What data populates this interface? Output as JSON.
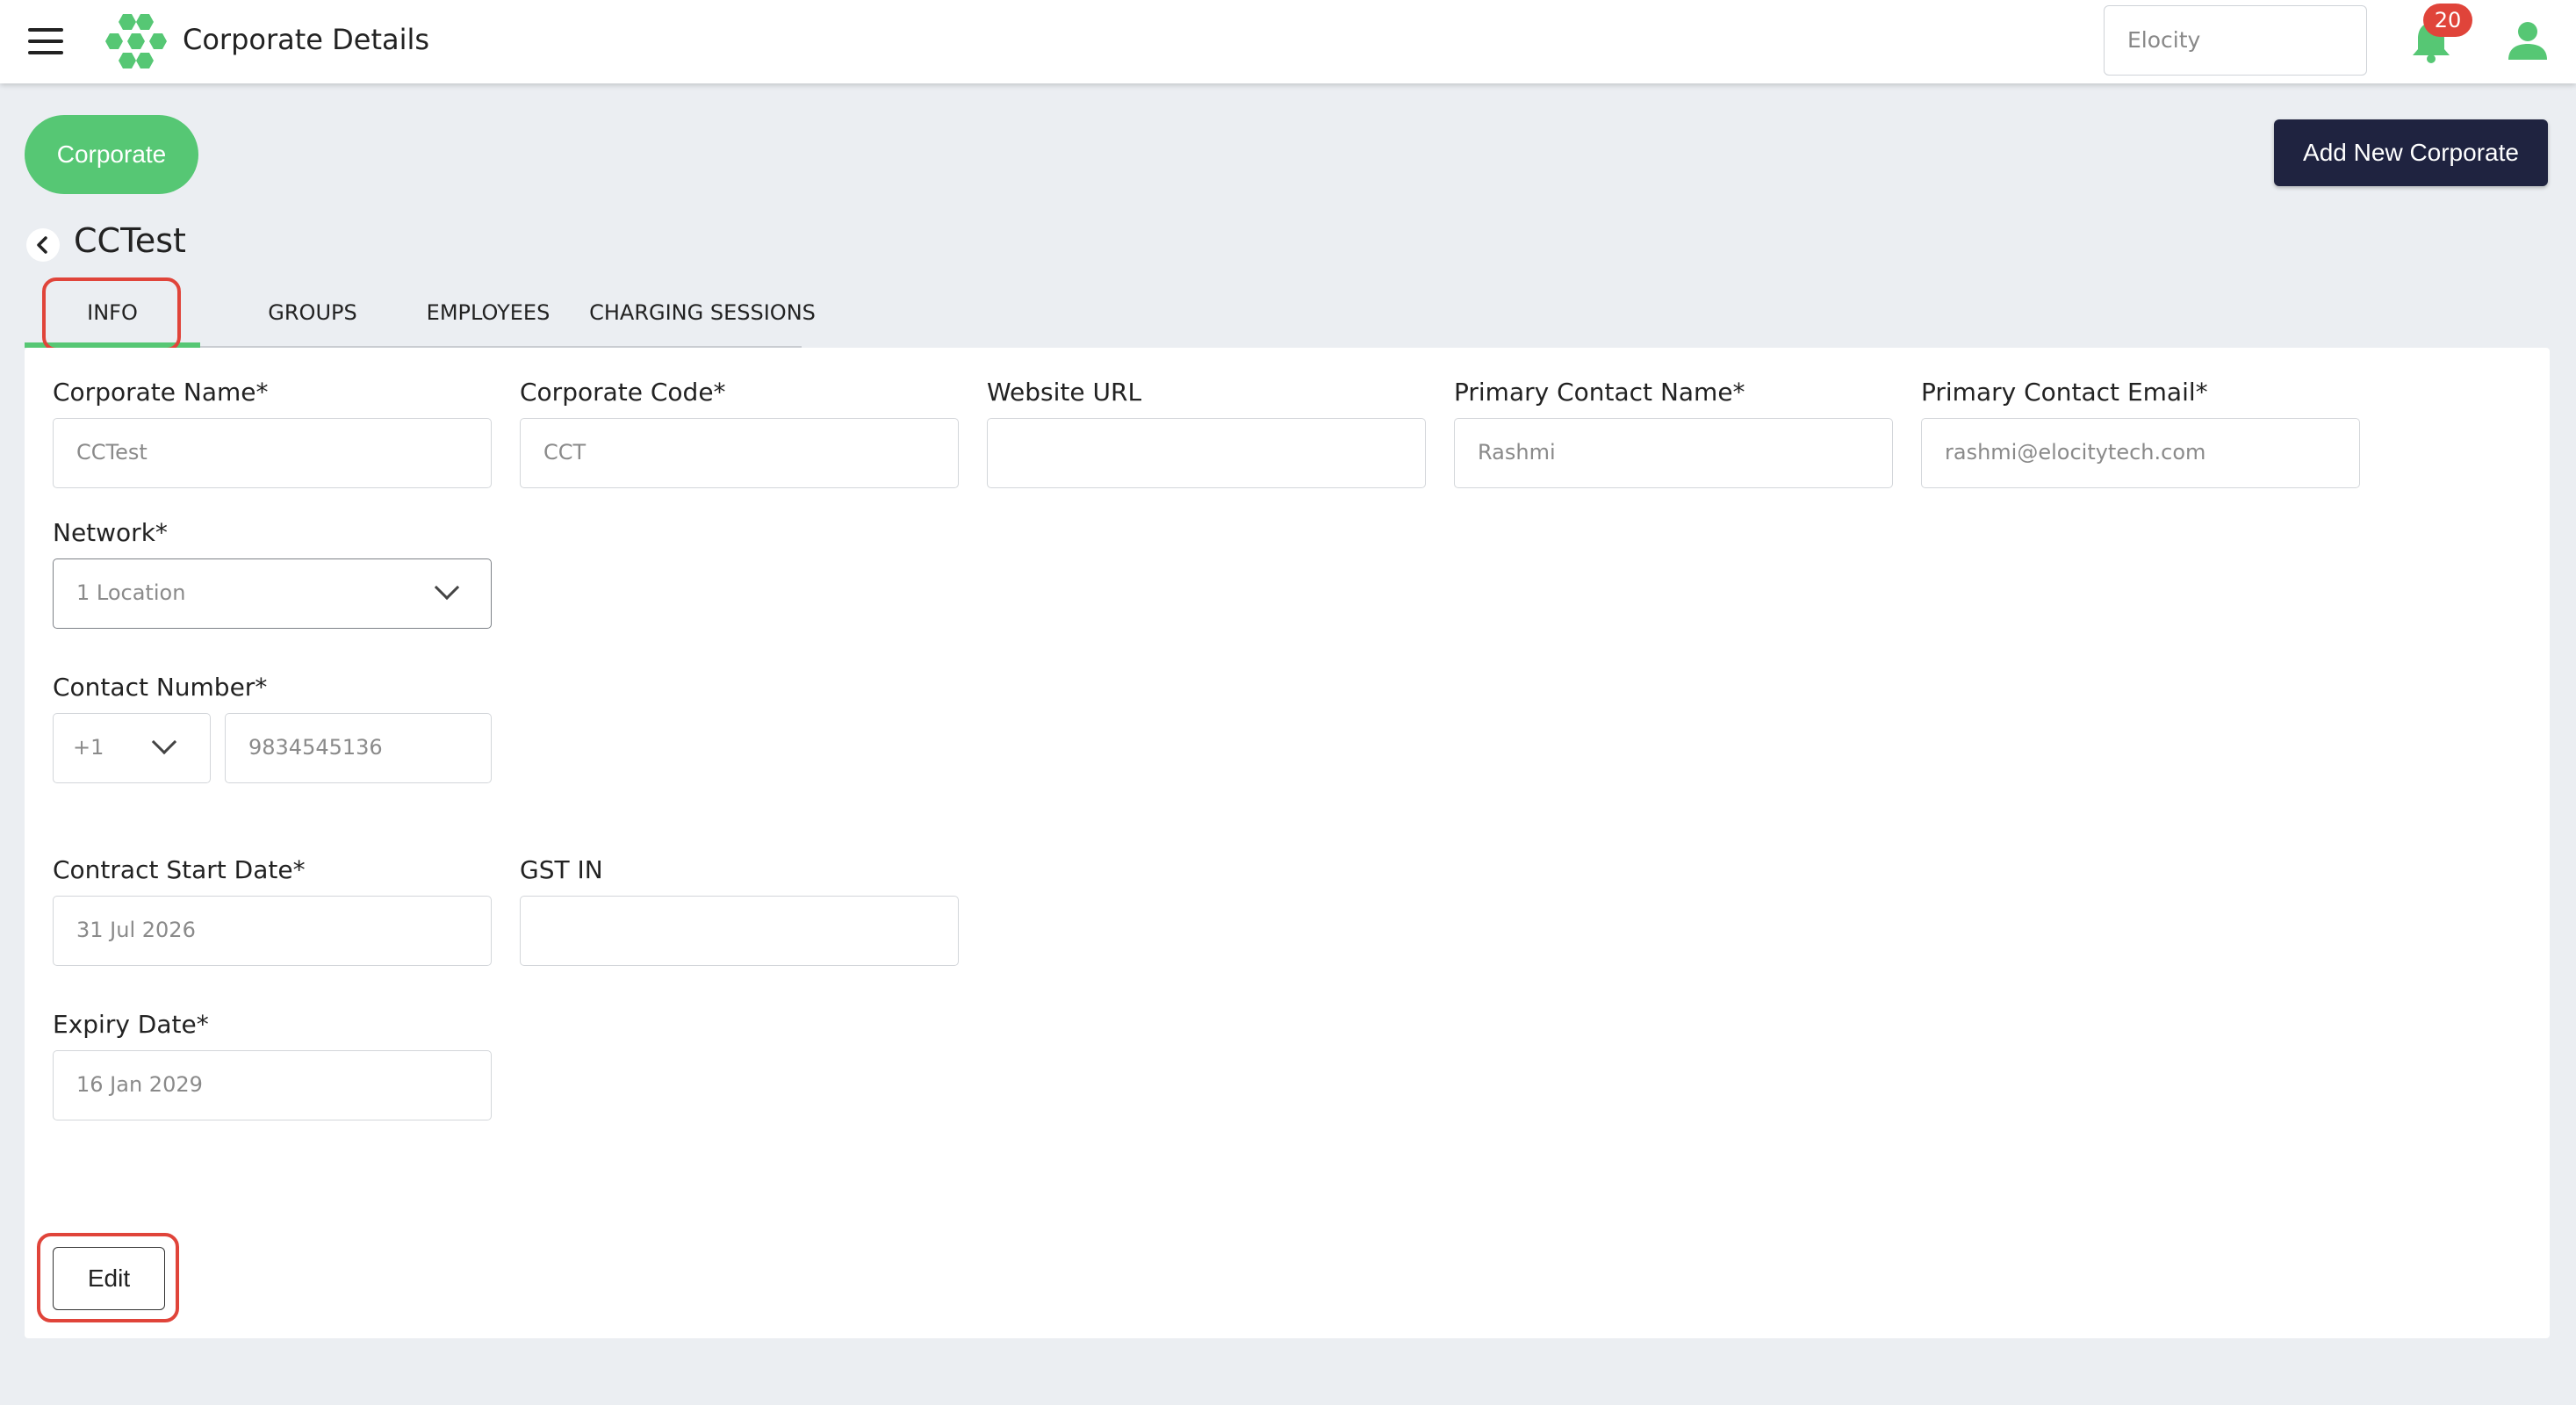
{
  "header": {
    "title": "Corporate Details",
    "search_value": "Elocity",
    "notification_count": "20",
    "brand_color": "#56c774"
  },
  "actions": {
    "corporate_label": "Corporate",
    "add_new_label": "Add New Corporate"
  },
  "page": {
    "corporate_name": "CCTest"
  },
  "tabs": [
    {
      "label": "INFO",
      "active": true
    },
    {
      "label": "GROUPS",
      "active": false
    },
    {
      "label": "EMPLOYEES",
      "active": false
    },
    {
      "label": "CHARGING SESSIONS",
      "active": false
    }
  ],
  "form": {
    "corporate_name": {
      "label": "Corporate Name*",
      "value": "CCTest"
    },
    "corporate_code": {
      "label": "Corporate Code*",
      "value": "CCT"
    },
    "website_url": {
      "label": "Website URL",
      "value": ""
    },
    "primary_contact_name": {
      "label": "Primary Contact Name*",
      "value": "Rashmi"
    },
    "primary_contact_email": {
      "label": "Primary Contact Email*",
      "value": "rashmi@elocitytech.com"
    },
    "network": {
      "label": "Network*",
      "value": "1 Location"
    },
    "contact_number": {
      "label": "Contact Number*",
      "country_code": "+1",
      "value": "9834545136"
    },
    "contract_start_date": {
      "label": "Contract Start Date*",
      "value": "31 Jul 2026"
    },
    "gst_in": {
      "label": "GST IN",
      "value": ""
    },
    "expiry_date": {
      "label": "Expiry Date*",
      "value": "16 Jan 2029"
    }
  },
  "edit_label": "Edit",
  "colors": {
    "accent_green": "#56c774",
    "dark_button": "#1f2340",
    "badge_red": "#e0443a",
    "annotation_red": "#e0443a"
  }
}
